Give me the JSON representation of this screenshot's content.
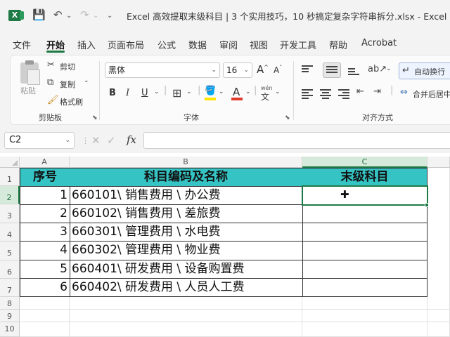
{
  "window": {
    "title": "Excel 高效提取末级科目 | 3 个实用技巧，10 秒搞定复杂字符串拆分.xlsx  -  Excel",
    "app_icon_letter": "X"
  },
  "quick_access": {
    "save_glyph": "💾",
    "undo_glyph": "↶",
    "redo_glyph": "↷",
    "more_glyph": "⌄"
  },
  "tabs": [
    "文件",
    "开始",
    "插入",
    "页面布局",
    "公式",
    "数据",
    "审阅",
    "视图",
    "开发工具",
    "帮助",
    "Acrobat"
  ],
  "ribbon": {
    "clipboard": {
      "label": "剪贴板",
      "paste": "粘贴",
      "cut": "剪切",
      "copy": "复制",
      "format_painter": "格式刷"
    },
    "font": {
      "label": "字体",
      "font_name": "黑体",
      "font_size": "16",
      "grow": "A",
      "shrink": "A",
      "bold": "B",
      "italic": "I",
      "underline": "U",
      "pinyin": "wén"
    },
    "alignment": {
      "label": "对齐方式",
      "wrap_text": "自动换行",
      "merge_center": "合并后居中"
    }
  },
  "formula_bar": {
    "name_box": "C2",
    "fx": "fx",
    "formula": ""
  },
  "grid": {
    "columns": [
      "A",
      "B",
      "C"
    ],
    "row_numbers": [
      "1",
      "2",
      "3",
      "4",
      "5",
      "6",
      "7",
      "8",
      "9",
      "10"
    ],
    "header": {
      "a": "序号",
      "b": "科目编码及名称",
      "c": "末级科目"
    },
    "rows": [
      {
        "a": "1",
        "b": "660101\\ 销售费用 \\ 办公费",
        "c": ""
      },
      {
        "a": "2",
        "b": "660102\\ 销售费用 \\ 差旅费",
        "c": ""
      },
      {
        "a": "3",
        "b": "660301\\ 管理费用 \\ 水电费",
        "c": ""
      },
      {
        "a": "4",
        "b": "660302\\ 管理费用 \\ 物业费",
        "c": ""
      },
      {
        "a": "5",
        "b": "660401\\ 研发费用 \\ 设备购置费",
        "c": ""
      },
      {
        "a": "6",
        "b": "660402\\ 研发费用 \\ 人员人工费",
        "c": ""
      }
    ],
    "active_cell": "C2",
    "colors": {
      "header_fill": "#35c3c4",
      "selection": "#1d7a45"
    }
  }
}
